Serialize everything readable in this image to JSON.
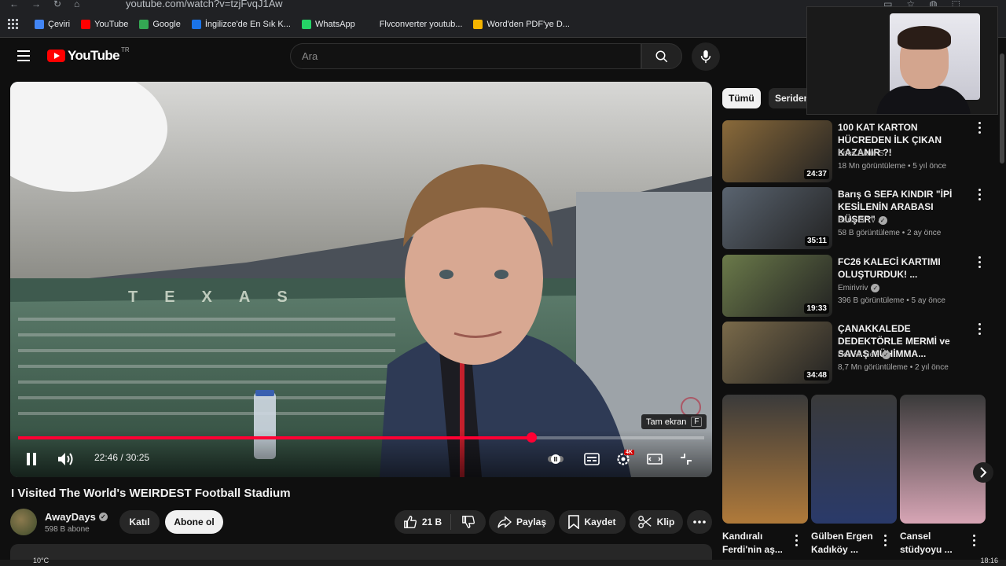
{
  "browser": {
    "url": "youtube.com/watch?v=tzjFvqJ1Aw",
    "bookmarks": [
      {
        "label": "Çeviri",
        "color": "#4285f4"
      },
      {
        "label": "YouTube",
        "color": "#ff0000"
      },
      {
        "label": "Google",
        "color": "#34a853"
      },
      {
        "label": "İngilizce'de En Sık K...",
        "color": "#1a73e8"
      },
      {
        "label": "WhatsApp",
        "color": "#25d366"
      },
      {
        "label": "Flvconverter youtub...",
        "color": "#202124"
      },
      {
        "label": "Word'den PDF'ye D...",
        "color": "#f4b400"
      }
    ]
  },
  "header": {
    "logo_text": "YouTube",
    "region": "TR",
    "search_placeholder": "Ara"
  },
  "player": {
    "current_time": "22:46",
    "duration": "30:25",
    "time_display": "22:46 / 30:25",
    "progress_fraction": 0.748,
    "tooltip": "Tam ekran",
    "tooltip_key": "F",
    "quality_badge": "4K",
    "stadium_text": "TEXAS"
  },
  "video": {
    "title": "I Visited The World's WEIRDEST Football Stadium",
    "channel": "AwayDays",
    "subscribers": "598 B abone",
    "join_label": "Katıl",
    "subscribe_label": "Abone ol",
    "likes": "21 B",
    "share_label": "Paylaş",
    "save_label": "Kaydet",
    "clip_label": "Klip"
  },
  "chips": [
    "Tümü",
    "Seriden"
  ],
  "recommendations": [
    {
      "title": "100 KAT KARTON HÜCREDEN İLK ÇIKAN KAZANIR ?!",
      "channel": "Enes Batur S",
      "verified": false,
      "meta": "18 Mn görüntüleme • 5 yıl önce",
      "duration": "24:37",
      "thumb_color": "#8a6a3a"
    },
    {
      "title": "Barış G SEFA KINDIR \"İPİ KESİLENİN ARABASI DÜŞER\" ...",
      "channel": "Barış G Tv",
      "verified": true,
      "meta": "58 B görüntüleme • 2 ay önce",
      "duration": "35:11",
      "thumb_color": "#5a6470"
    },
    {
      "title": "FC26 KALECİ KARTIMI OLUŞTURDUK! ...",
      "channel": "Emirivriv",
      "verified": true,
      "meta": "396 B görüntüleme • 5 ay önce",
      "duration": "19:33",
      "thumb_color": "#6b7a4a"
    },
    {
      "title": "ÇANAKKALEDE DEDEKTÖRLE MERMİ ve SAVAŞ MÜHİMMA...",
      "channel": "Deli Mi Ne?",
      "verified": true,
      "meta": "8,7 Mn görüntüleme • 2 yıl önce",
      "duration": "34:48",
      "thumb_color": "#7a6a4a"
    }
  ],
  "shorts": [
    {
      "title": "Kandıralı Ferdi'nin aş...",
      "color": "#b07a3a"
    },
    {
      "title": "Gülben Ergen Kadıköy ...",
      "color": "#2a3a6a"
    },
    {
      "title": "Cansel stüdyoyu ...",
      "color": "#d7a5b5"
    }
  ],
  "taskbar": {
    "temperature": "10°C",
    "clock": "18:16"
  }
}
